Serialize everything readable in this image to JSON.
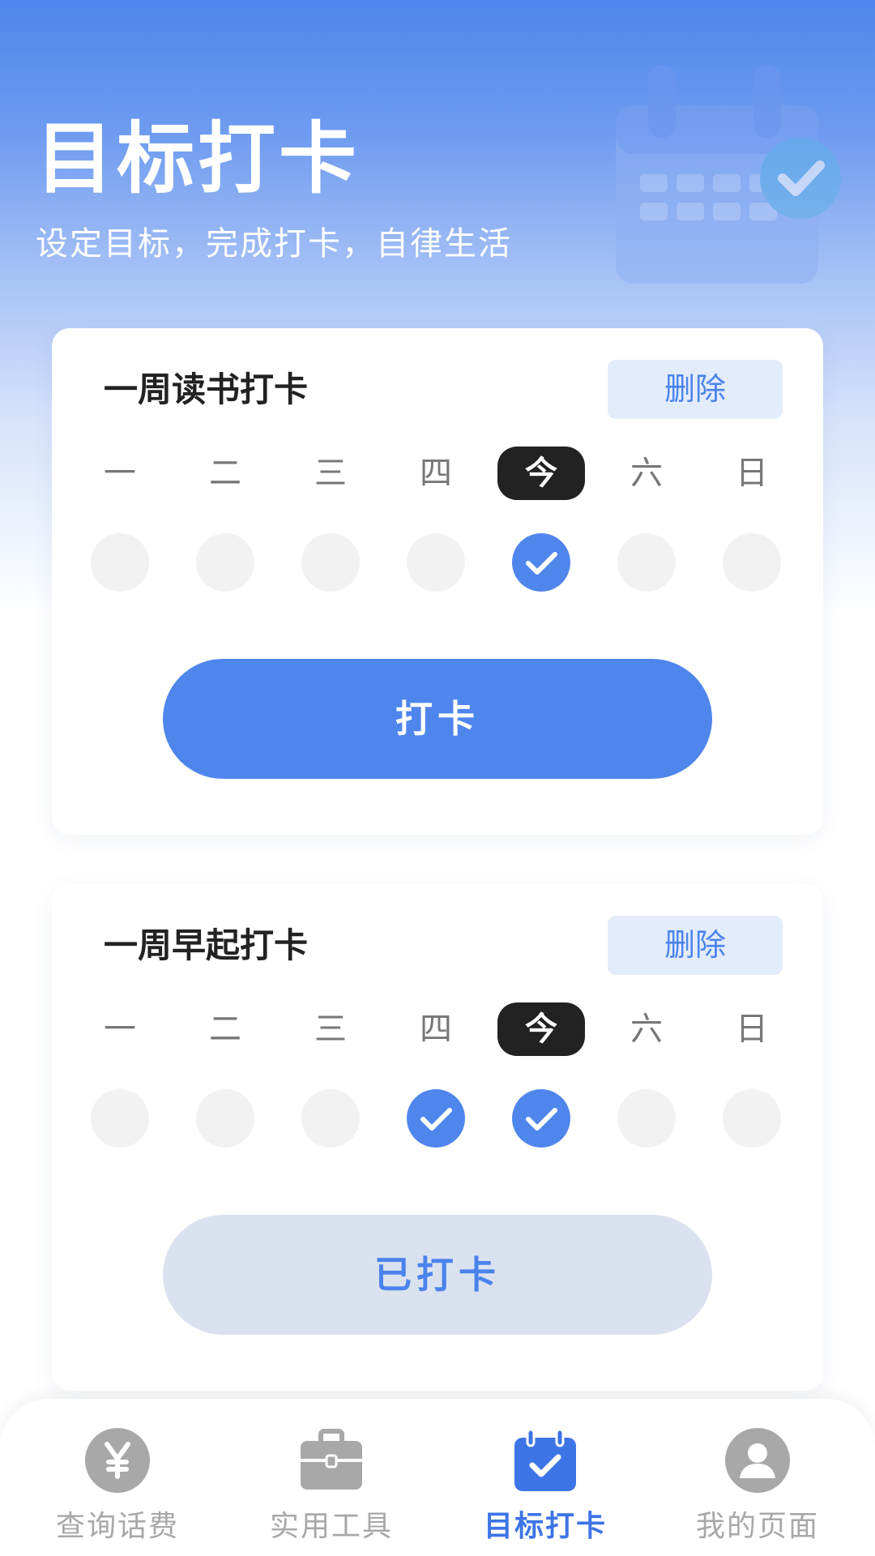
{
  "header": {
    "title": "目标打卡",
    "subtitle": "设定目标，完成打卡，自律生活"
  },
  "weekdays": [
    "一",
    "二",
    "三",
    "四",
    "今",
    "六",
    "日"
  ],
  "goals": [
    {
      "title": "一周读书打卡",
      "delete_label": "删除",
      "today_index": 4,
      "checked_days": [
        4
      ],
      "button_label": "打卡",
      "button_state": "primary"
    },
    {
      "title": "一周早起打卡",
      "delete_label": "删除",
      "today_index": 4,
      "checked_days": [
        3,
        4
      ],
      "button_label": "已打卡",
      "button_state": "done"
    }
  ],
  "tabbar": {
    "items": [
      {
        "label": "查询话费",
        "icon": "yen-icon",
        "active": false
      },
      {
        "label": "实用工具",
        "icon": "toolbox-icon",
        "active": false
      },
      {
        "label": "目标打卡",
        "icon": "calendar-check-icon",
        "active": true
      },
      {
        "label": "我的页面",
        "icon": "user-icon",
        "active": false
      }
    ]
  },
  "colors": {
    "accent": "#4f86ec",
    "today_bg": "#222222",
    "inactive_dot": "#f2f2f2",
    "done_button": "#dbe2ef",
    "delete_bg": "#e3ecfb",
    "tab_inactive": "#a8a8a8",
    "tab_active": "#3d74e6"
  }
}
